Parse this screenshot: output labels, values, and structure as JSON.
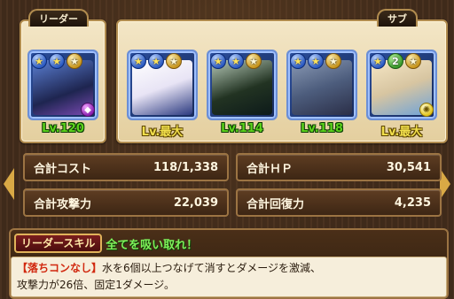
{
  "leader": {
    "tag": "リーダー",
    "level": "Lv.120",
    "awakening_count": ""
  },
  "sub": {
    "tag": "サブ",
    "members": [
      {
        "level": "Lv.最大",
        "badge": ""
      },
      {
        "level": "Lv.114",
        "badge": ""
      },
      {
        "level": "Lv.118",
        "badge": ""
      },
      {
        "level": "Lv.最大",
        "badge": "2"
      }
    ]
  },
  "stats": {
    "cost_label": "合計コスト",
    "cost_value": "118/1,338",
    "hp_label": "合計ＨＰ",
    "hp_value": "30,541",
    "atk_label": "合計攻撃力",
    "atk_value": "22,039",
    "rcv_label": "合計回復力",
    "rcv_value": "4,235"
  },
  "leader_skill": {
    "tag": "リーダースキル",
    "name": "全てを吸い取れ！",
    "highlight": "【落ちコンなし】",
    "desc_line1": "水を6個以上つなげて消すとダメージを激減、",
    "desc_line2": "攻撃力が26倍、固定1ダメージ。"
  },
  "colors": {
    "level_green": "#5cd31c",
    "level_max_yellow": "#f1df4b",
    "skill_name_green": "#7ef15a",
    "highlight_red": "#d1280f"
  }
}
